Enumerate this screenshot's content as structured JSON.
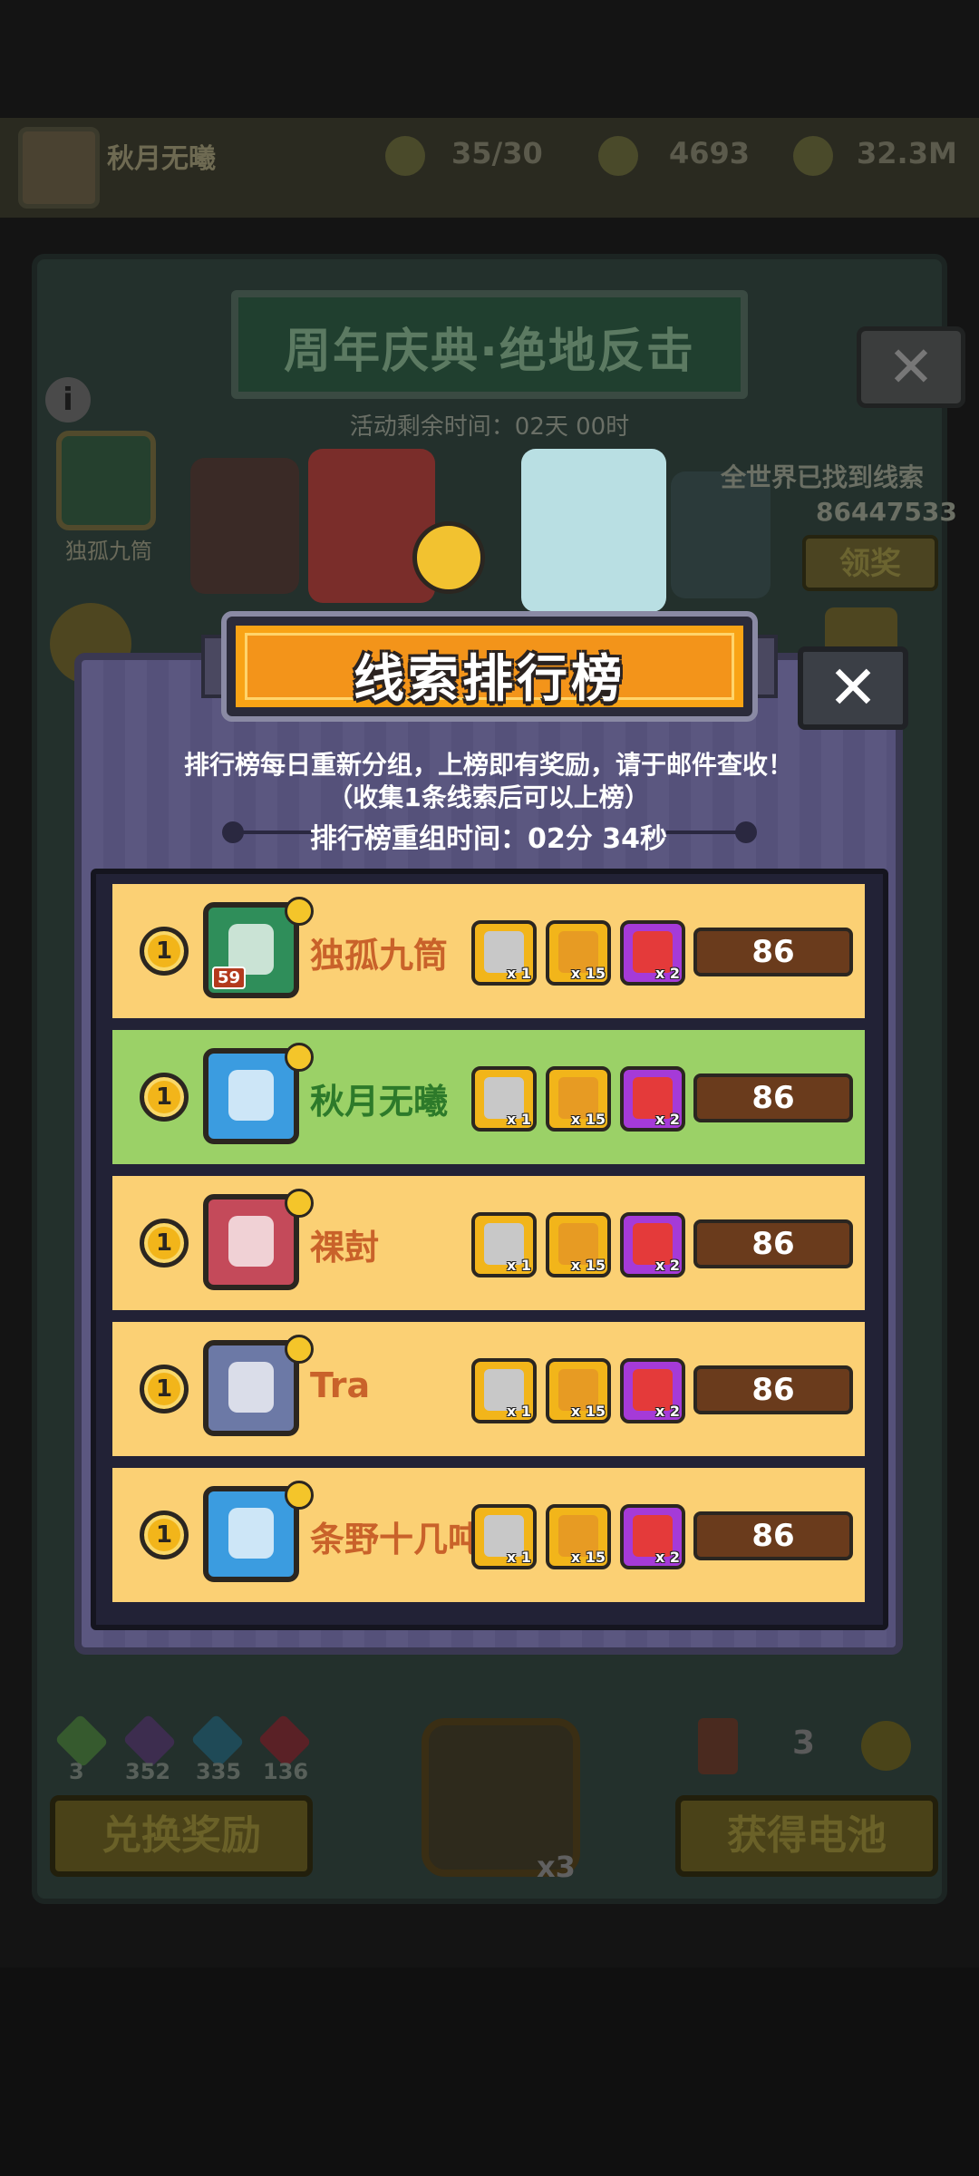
{
  "background": {
    "player_name": "秋月无曦",
    "resources": [
      "35/30",
      "4693",
      "32.3M"
    ],
    "event_title": "周年庆典·绝地反击",
    "event_timer": "活动剩余时间：02天 00时",
    "side_card_label": "独孤九筒",
    "clue_text": "全世界已找到线索",
    "clue_count": "86447533",
    "claim_label": "领奖",
    "gems": [
      "3",
      "352",
      "335",
      "136"
    ],
    "exchange_button": "兑换奖励",
    "battery_count": "3",
    "lock_multiplier": "x3",
    "get_battery_button": "获得电池"
  },
  "modal": {
    "title": "线索排行榜",
    "close_icon": "close-icon",
    "info_line1": "排行榜每日重新分组，上榜即有奖励，请于邮件查收！",
    "info_line2": "（收集1条线索后可以上榜）",
    "reset_time": "排行榜重组时间：02分 34秒",
    "rows": [
      {
        "rank": "1",
        "name": "独孤九筒",
        "score": "86",
        "bg": "#fbd074",
        "name_color": "#c9622a",
        "avatar_bg": "#2f8e5a",
        "level": "59",
        "rewards": [
          {
            "qty": "x 1",
            "kind": "silver-chest"
          },
          {
            "qty": "x 15",
            "kind": "coin-chest"
          },
          {
            "qty": "x 2",
            "kind": "gift-box"
          }
        ]
      },
      {
        "rank": "1",
        "name": "秋月无曦",
        "score": "86",
        "bg": "#9bd167",
        "name_color": "#2d7a2a",
        "avatar_bg": "#3b9ce0",
        "level": "",
        "rewards": [
          {
            "qty": "x 1",
            "kind": "silver-chest"
          },
          {
            "qty": "x 15",
            "kind": "coin-chest"
          },
          {
            "qty": "x 2",
            "kind": "gift-box"
          }
        ]
      },
      {
        "rank": "1",
        "name": "祼尌",
        "score": "86",
        "bg": "#fbd074",
        "name_color": "#c9622a",
        "avatar_bg": "#c44a5a",
        "level": "",
        "rewards": [
          {
            "qty": "x 1",
            "kind": "silver-chest"
          },
          {
            "qty": "x 15",
            "kind": "coin-chest"
          },
          {
            "qty": "x 2",
            "kind": "gift-box"
          }
        ]
      },
      {
        "rank": "1",
        "name": "Tra",
        "score": "86",
        "bg": "#fbd074",
        "name_color": "#c9622a",
        "avatar_bg": "#6c79a6",
        "level": "",
        "rewards": [
          {
            "qty": "x 1",
            "kind": "silver-chest"
          },
          {
            "qty": "x 15",
            "kind": "coin-chest"
          },
          {
            "qty": "x 2",
            "kind": "gift-box"
          }
        ]
      },
      {
        "rank": "1",
        "name": "条野十几吨",
        "score": "86",
        "bg": "#fbd074",
        "name_color": "#c9622a",
        "avatar_bg": "#3b9ce0",
        "level": "",
        "rewards": [
          {
            "qty": "x 1",
            "kind": "silver-chest"
          },
          {
            "qty": "x 15",
            "kind": "coin-chest"
          },
          {
            "qty": "x 2",
            "kind": "gift-box"
          }
        ]
      }
    ]
  }
}
